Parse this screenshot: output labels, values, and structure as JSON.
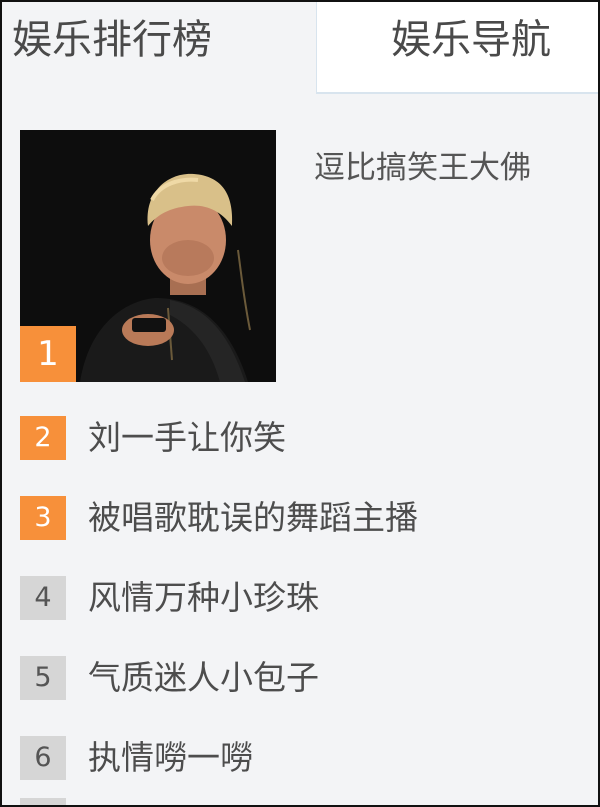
{
  "tabs": [
    {
      "label": "娱乐排行榜",
      "active": true
    },
    {
      "label": "娱乐导航",
      "active": false
    }
  ],
  "featured": {
    "rank": "1",
    "title": "逗比搞笑王大佛",
    "thumbnail": "streamer-photo"
  },
  "ranking": [
    {
      "rank": "2",
      "name": "刘一手让你笑"
    },
    {
      "rank": "3",
      "name": "被唱歌耽误的舞蹈主播"
    },
    {
      "rank": "4",
      "name": "风情万种小珍珠"
    },
    {
      "rank": "5",
      "name": "气质迷人小包子"
    },
    {
      "rank": "6",
      "name": "执情嘮一嘮"
    }
  ],
  "colors": {
    "hot_badge": "#f7903a",
    "cold_badge": "#d6d6d6",
    "background": "#f3f4f6"
  }
}
